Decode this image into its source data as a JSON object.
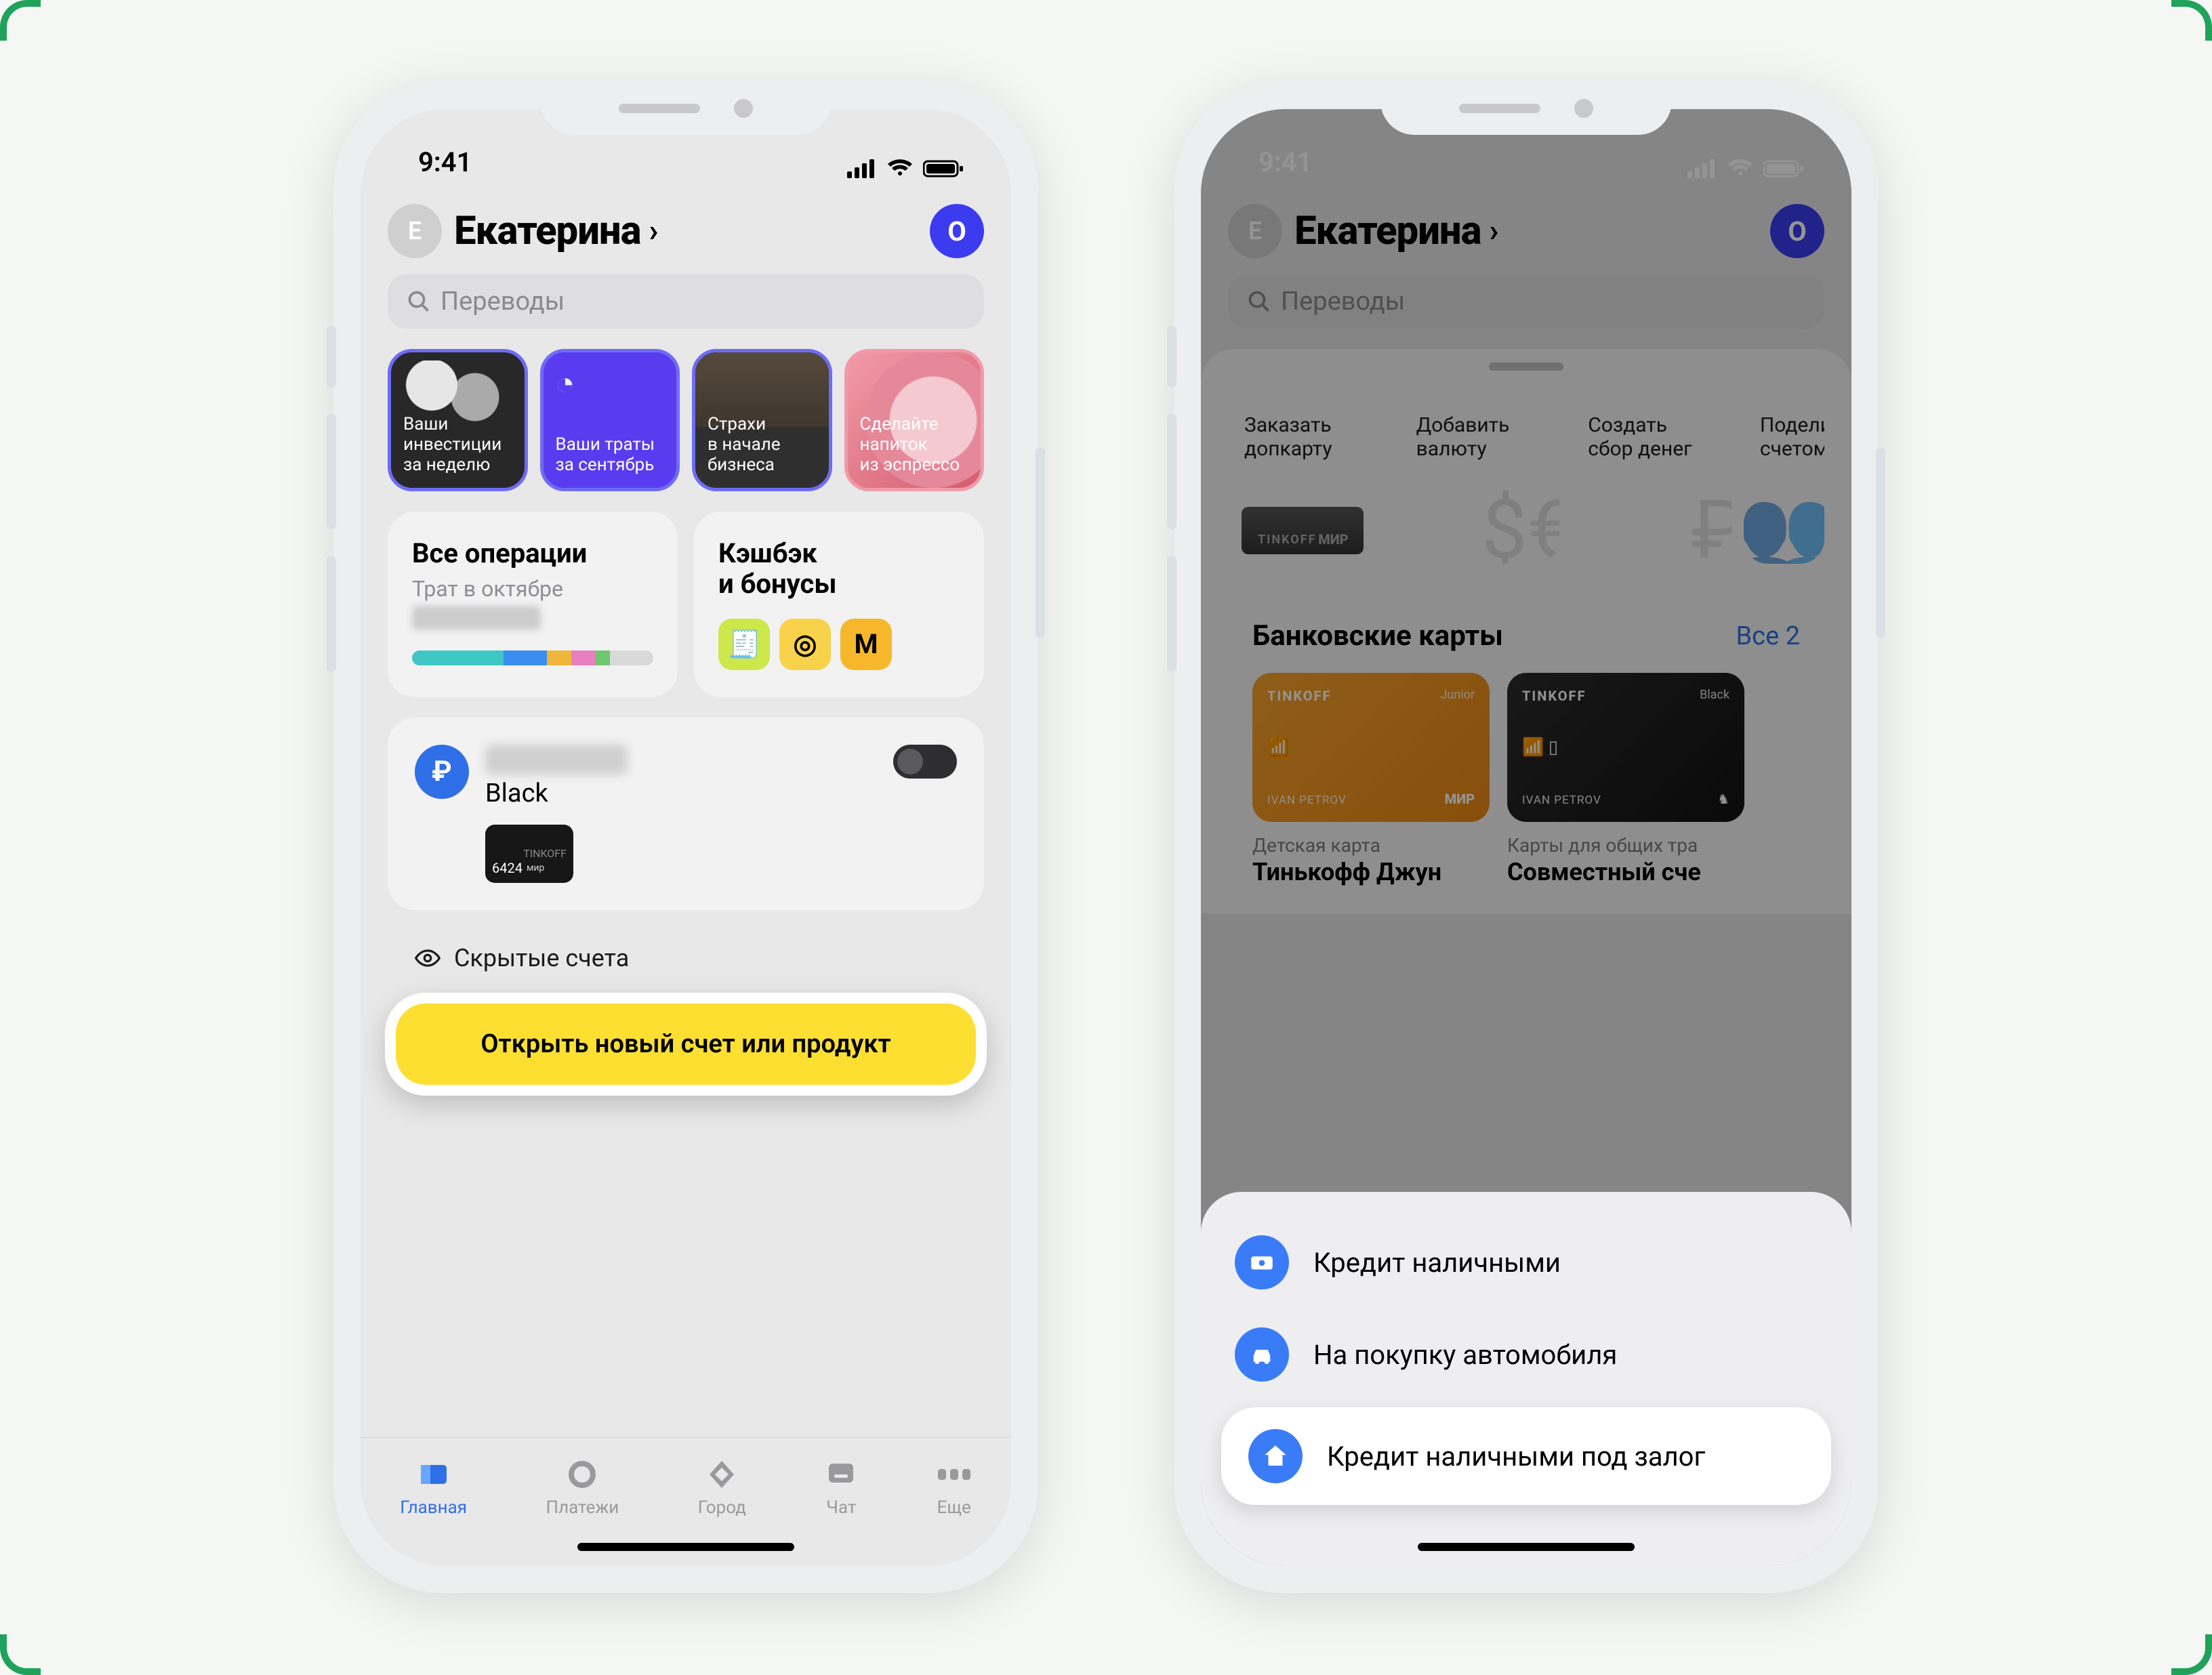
{
  "status": {
    "time": "9:41"
  },
  "header": {
    "initial": "Е",
    "username": "Екатерина",
    "right_badge": "О"
  },
  "search": {
    "placeholder": "Переводы"
  },
  "stories": [
    {
      "line1": "Ваши",
      "line2": "инвестиции",
      "line3": "за неделю"
    },
    {
      "line1": "Ваши траты",
      "line2": "за сентябрь"
    },
    {
      "line1": "Страхи",
      "line2": "в начале",
      "line3": "бизнеса"
    },
    {
      "line1": "Сделайте",
      "line2": "напиток",
      "line3": "из эспрессо"
    }
  ],
  "operations": {
    "title": "Все операции",
    "subtitle": "Трат в октябре",
    "segments": [
      {
        "color": "#3ec7c4",
        "pct": 38
      },
      {
        "color": "#3a8ef0",
        "pct": 18
      },
      {
        "color": "#f0b63a",
        "pct": 10
      },
      {
        "color": "#e97fbf",
        "pct": 10
      },
      {
        "color": "#6fc76f",
        "pct": 6
      },
      {
        "color": "#d9d9d9",
        "pct": 18
      }
    ]
  },
  "cashback": {
    "title_l1": "Кэшбэк",
    "title_l2": "и бонусы",
    "icons": [
      {
        "bg": "#cde84a",
        "glyph": "🧾"
      },
      {
        "bg": "#f8d24a",
        "glyph": "◎"
      },
      {
        "bg": "#f6b72b",
        "glyph": "М"
      }
    ]
  },
  "account": {
    "currency": "₽",
    "name": "Black",
    "card_brand": "TINKOFF",
    "card_last": "6424",
    "card_system": "мир"
  },
  "hidden_accounts": "Скрытые счета",
  "cta": "Открыть новый счет или продукт",
  "tabs": [
    {
      "label": "Главная"
    },
    {
      "label": "Платежи"
    },
    {
      "label": "Город"
    },
    {
      "label": "Чат"
    },
    {
      "label": "Еще"
    }
  ],
  "phone2": {
    "quick": [
      {
        "l1": "Заказать",
        "l2": "допкарту"
      },
      {
        "l1": "Добавить",
        "l2": "валюту"
      },
      {
        "l1": "Создать",
        "l2": "сбор денег"
      },
      {
        "l1": "Подели",
        "l2": "счетом"
      }
    ],
    "cards_section": {
      "title": "Банковские карты",
      "all_label": "Все 2"
    },
    "cards": [
      {
        "brand": "TINKOFF",
        "tier": "Junior",
        "holder": "IVAN PETROV",
        "system": "МИР",
        "caption": "Детская карта",
        "title": "Тинькофф Джун"
      },
      {
        "brand": "TINKOFF",
        "tier": "Black",
        "holder": "IVAN PETROV",
        "system": "",
        "caption": "Карты для общих тра",
        "title": "Совместный сче"
      }
    ],
    "menu": [
      {
        "label": "Кредит наличными",
        "icon": "cash"
      },
      {
        "label": "На покупку автомобиля",
        "icon": "car"
      },
      {
        "label": "Кредит наличными под залог",
        "icon": "home",
        "selected": true
      }
    ]
  }
}
